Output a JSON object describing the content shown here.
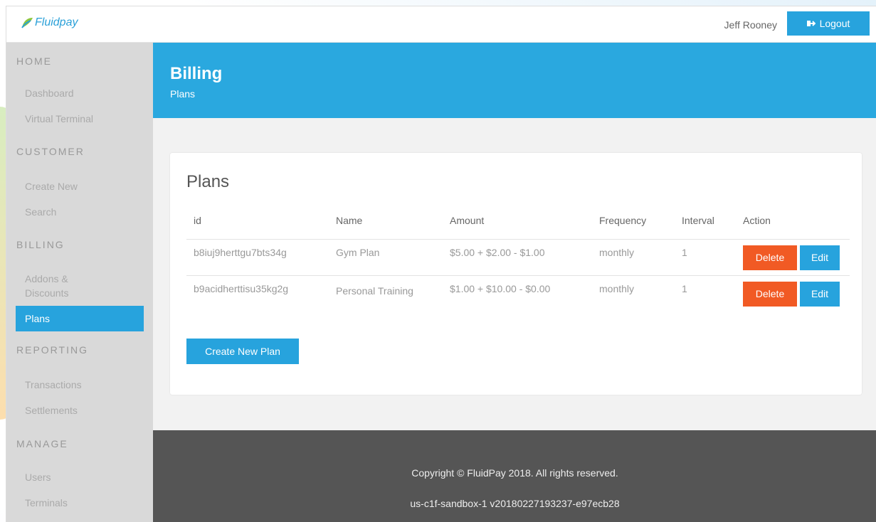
{
  "app": {
    "logo_text": "Fluidpay"
  },
  "topbar": {
    "user_name": "Jeff Rooney",
    "logout_label": "Logout"
  },
  "sidebar": {
    "groups": [
      {
        "title": "HOME",
        "items": [
          "Dashboard",
          "Virtual Terminal"
        ]
      },
      {
        "title": "CUSTOMER",
        "items": [
          "Create New",
          "Search"
        ]
      },
      {
        "title": "BILLING",
        "items": [
          "Addons &\nDiscounts",
          "Plans"
        ]
      },
      {
        "title": "REPORTING",
        "items": [
          "Transactions",
          "Settlements"
        ]
      },
      {
        "title": "MANAGE",
        "items": [
          "Users",
          "Terminals"
        ]
      }
    ],
    "active_item": "Plans"
  },
  "header": {
    "title": "Billing",
    "subtitle": "Plans"
  },
  "card": {
    "title": "Plans",
    "columns": [
      "id",
      "Name",
      "Amount",
      "Frequency",
      "Interval",
      "Action"
    ],
    "rows": [
      {
        "id": "b8iuj9herttgu7bts34g",
        "name": "Gym Plan",
        "amount": "$5.00 + $2.00 - $1.00",
        "frequency": "monthly",
        "interval": "1"
      },
      {
        "id": "b9acidherttisu35kg2g",
        "name": "Personal Training",
        "amount": "$1.00 + $10.00 - $0.00",
        "frequency": "monthly",
        "interval": "1"
      }
    ],
    "delete_label": "Delete",
    "edit_label": "Edit",
    "create_label": "Create New Plan"
  },
  "footer": {
    "copyright": "Copyright © FluidPay 2018. All rights reserved.",
    "version": "us-c1f-sandbox-1 v20180227193237-e97ecb28"
  },
  "colors": {
    "primary": "#27a3dd",
    "danger": "#f15a24",
    "sidebar": "#d9d9d9",
    "footer": "#555555"
  }
}
